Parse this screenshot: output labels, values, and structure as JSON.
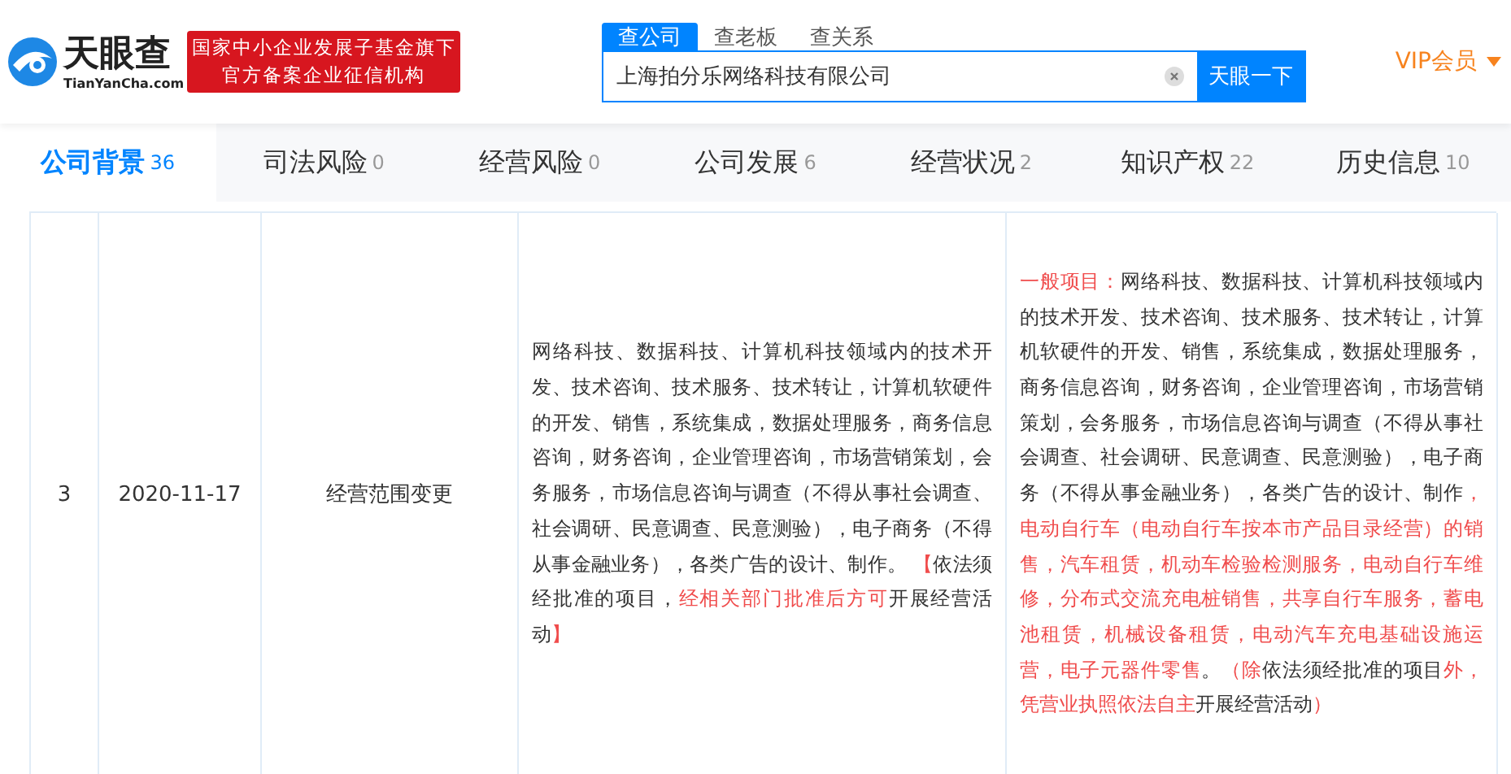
{
  "header": {
    "logo_text": "天眼查",
    "logo_domain": "TianYanCha.com",
    "badge_lines": [
      "国家中小企业发展子基金旗下",
      "官方备案企业征信机构"
    ],
    "search_tabs": [
      {
        "label": "查公司",
        "selected": true
      },
      {
        "label": "查老板",
        "selected": false
      },
      {
        "label": "查关系",
        "selected": false
      }
    ],
    "search_value": "上海拍分乐网络科技有限公司",
    "search_button": "天眼一下",
    "vip": "VIP会员"
  },
  "tabs": [
    {
      "label": "公司背景",
      "count": "36",
      "selected": true
    },
    {
      "label": "司法风险",
      "count": "0",
      "selected": false
    },
    {
      "label": "经营风险",
      "count": "0",
      "selected": false
    },
    {
      "label": "公司发展",
      "count": "6",
      "selected": false
    },
    {
      "label": "经营状况",
      "count": "2",
      "selected": false
    },
    {
      "label": "知识产权",
      "count": "22",
      "selected": false
    },
    {
      "label": "历史信息",
      "count": "10",
      "selected": false
    }
  ],
  "table": {
    "rows": [
      {
        "index": "3",
        "date": "2020-11-17",
        "item": "经营范围变更",
        "before": [
          {
            "text": "网络科技、数据科技、计算机科技领域内的技术开发、技术咨询、技术服务、技术转让，计算机软硬件的开发、销售，系统集成，数据处理服务，商务信息咨询，财务咨询，企业管理咨询，市场营销策划，会务服务，市场信息咨询与调查（不得从事社会调查、社会调研、民意调查、民意测验），电子商务（不得从事金融业务），各类广告的设计、制作。 ",
            "highlight": false
          },
          {
            "text": "【",
            "highlight": true
          },
          {
            "text": "依法须经批准的项目，",
            "highlight": false
          },
          {
            "text": "经相关部门批准后方可",
            "highlight": true
          },
          {
            "text": "开展经营活动",
            "highlight": false
          },
          {
            "text": "】",
            "highlight": true
          }
        ],
        "after": [
          {
            "text": "一般项目：",
            "highlight": true
          },
          {
            "text": "网络科技、数据科技、计算机科技领域内的技术开发、技术咨询、技术服务、技术转让，计算机软硬件的开发、销售，系统集成，数据处理服务，商务信息咨询，财务咨询，企业管理咨询，市场营销策划，会务服务，市场信息咨询与调查（不得从事社会调查、社会调研、民意调查、民意测验），电子商务（不得从事金融业务），各类广告的设计、制作",
            "highlight": false
          },
          {
            "text": "，电动自行车（电动自行车按本市产品目录经营）的销售，汽车租赁，机动车检验检测服务，电动自行车维修，分布式交流充电桩销售，共享自行车服务，蓄电池租赁，机械设备租赁，电动汽车充电基础设施运营，电子元器件零售",
            "highlight": true
          },
          {
            "text": "。",
            "highlight": false
          },
          {
            "text": "（除",
            "highlight": true
          },
          {
            "text": "依法须经批准的项目",
            "highlight": false
          },
          {
            "text": "外，凭营业执照依法自主",
            "highlight": true
          },
          {
            "text": "开展经营活动",
            "highlight": false
          },
          {
            "text": "）",
            "highlight": true
          }
        ]
      }
    ]
  }
}
